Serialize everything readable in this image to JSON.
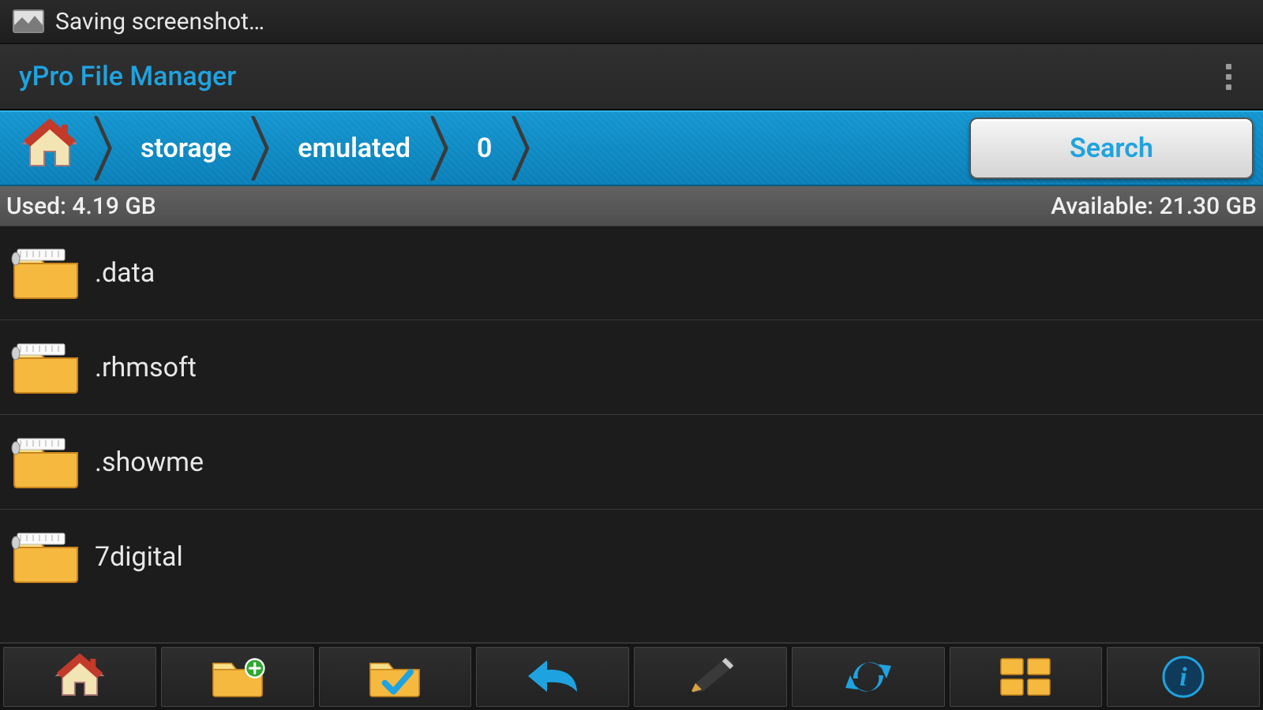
{
  "status": {
    "text": "Saving screenshot…"
  },
  "app": {
    "title": "yPro File Manager"
  },
  "breadcrumb": {
    "items": [
      "storage",
      "emulated",
      "0"
    ],
    "search_label": "Search"
  },
  "usage": {
    "used_label": "Used: 4.19 GB",
    "available_label": "Available: 21.30 GB"
  },
  "files": [
    {
      "name": ".data"
    },
    {
      "name": ".rhmsoft"
    },
    {
      "name": ".showme"
    },
    {
      "name": "7digital"
    }
  ],
  "toolbar": {
    "buttons": [
      {
        "id": "home",
        "name": "home-button"
      },
      {
        "id": "new-folder",
        "name": "new-folder-button"
      },
      {
        "id": "select",
        "name": "select-button"
      },
      {
        "id": "back",
        "name": "back-button"
      },
      {
        "id": "edit",
        "name": "edit-button"
      },
      {
        "id": "sync",
        "name": "sync-button"
      },
      {
        "id": "view",
        "name": "view-button"
      },
      {
        "id": "info",
        "name": "info-button"
      }
    ]
  }
}
